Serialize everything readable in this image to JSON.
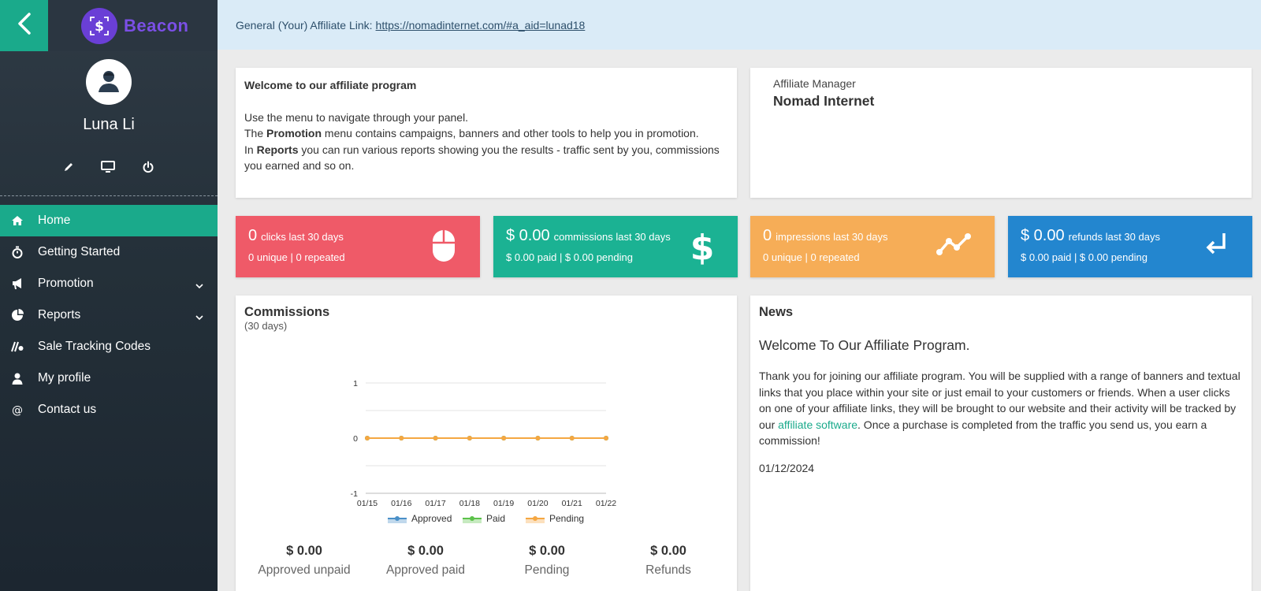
{
  "brand": {
    "name": "Beacon"
  },
  "user": {
    "name": "Luna Li"
  },
  "nav": {
    "items": [
      {
        "label": "Home"
      },
      {
        "label": "Getting Started"
      },
      {
        "label": "Promotion"
      },
      {
        "label": "Reports"
      },
      {
        "label": "Sale Tracking Codes"
      },
      {
        "label": "My profile"
      },
      {
        "label": "Contact us"
      }
    ]
  },
  "banner": {
    "label": "General (Your) Affiliate Link:",
    "link": "https://nomadinternet.com/#a_aid=lunad18"
  },
  "welcome": {
    "title": "Welcome to our affiliate program",
    "line1": "Use the menu to navigate through your panel.",
    "line2_pre": "The",
    "line2_bold": "Promotion",
    "line2_post": "menu contains campaigns, banners and other tools to help you in promotion.",
    "line3_pre": "In",
    "line3_bold": "Reports",
    "line3_post": "you can run various reports showing you the results - traffic sent by you, commissions you earned and so on."
  },
  "manager": {
    "label": "Affiliate Manager",
    "name": "Nomad Internet"
  },
  "stats": {
    "clicks": {
      "big": "0",
      "small": "clicks last 30 days",
      "sub": "0 unique | 0 repeated"
    },
    "commissions": {
      "big": "$ 0.00",
      "small": "commissions last 30 days",
      "sub": "$ 0.00 paid | $ 0.00 pending"
    },
    "impressions": {
      "big": "0",
      "small": "impressions last 30 days",
      "sub": "0 unique | 0 repeated"
    },
    "refunds": {
      "big": "$ 0.00",
      "small": "refunds last 30 days",
      "sub": "$ 0.00 paid | $ 0.00 pending"
    }
  },
  "commissions_card": {
    "title": "Commissions",
    "subtitle": "(30 days)",
    "totals": [
      {
        "amount": "$ 0.00",
        "label": "Approved unpaid"
      },
      {
        "amount": "$ 0.00",
        "label": "Approved paid"
      },
      {
        "amount": "$ 0.00",
        "label": "Pending"
      },
      {
        "amount": "$ 0.00",
        "label": "Refunds"
      }
    ]
  },
  "chart_data": {
    "type": "line",
    "x": [
      "01/15",
      "01/16",
      "01/17",
      "01/18",
      "01/19",
      "01/20",
      "01/21",
      "01/22"
    ],
    "series": [
      {
        "name": "Approved",
        "values": [
          0,
          0,
          0,
          0,
          0,
          0,
          0,
          0
        ],
        "color": "#4a90c8"
      },
      {
        "name": "Paid",
        "values": [
          0,
          0,
          0,
          0,
          0,
          0,
          0,
          0
        ],
        "color": "#5cc24a"
      },
      {
        "name": "Pending",
        "values": [
          0,
          0,
          0,
          0,
          0,
          0,
          0,
          0
        ],
        "color": "#f5a742"
      }
    ],
    "yticks": [
      1,
      0,
      -1
    ],
    "ylim": [
      -1,
      1
    ],
    "grid": true,
    "legend": "bottom"
  },
  "news": {
    "title": "News",
    "headline": "Welcome To Our Affiliate Program.",
    "body_pre": "Thank you for joining our affiliate program. You will be supplied with a range of banners and textual links that you place within your site or just email to your customers or friends. When a user clicks on one of your affiliate links, they will be brought to our website and their activity will be tracked by our",
    "body_link": "affiliate software",
    "body_post": ". Once a purchase is completed from the traffic you send us, you earn a commission!",
    "date": "01/12/2024"
  },
  "colors": {
    "accent": "#1aaa8b",
    "clicks": "#ef5a68",
    "commissions": "#1bb293",
    "impressions": "#f6ad57",
    "refunds": "#2386cf",
    "brand": "#6a3fd6"
  }
}
